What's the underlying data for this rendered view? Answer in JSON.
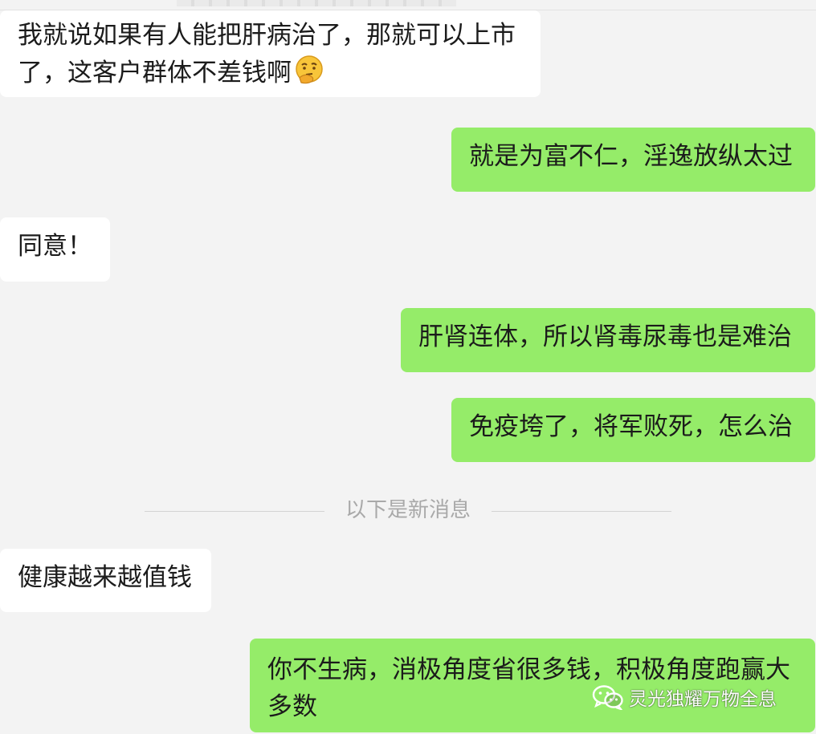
{
  "messages": [
    {
      "side": "in",
      "text": "我就说如果有人能把肝病治了，那就可以上市了，这客户群体不差钱啊",
      "emoji": "thinking-face-icon"
    },
    {
      "side": "out",
      "text": "就是为富不仁，淫逸放纵太过"
    },
    {
      "side": "in",
      "text": "同意！"
    },
    {
      "side": "out",
      "text": "肝肾连体，所以肾毒尿毒也是难治"
    },
    {
      "side": "out",
      "text": "免疫垮了，将军败死，怎么治"
    },
    {
      "side": "in",
      "text": "健康越来越值钱"
    },
    {
      "side": "out",
      "text": "你不生病，消极角度省很多钱，积极角度跑赢大多数"
    }
  ],
  "divider": {
    "label": "以下是新消息"
  },
  "watermark": {
    "text": "灵光独耀万物全息",
    "icon": "wechat-icon"
  },
  "colors": {
    "background": "#f3f3f3",
    "incoming_bubble": "#ffffff",
    "outgoing_bubble": "#95ec69",
    "divider_text": "#a9a9a9"
  }
}
